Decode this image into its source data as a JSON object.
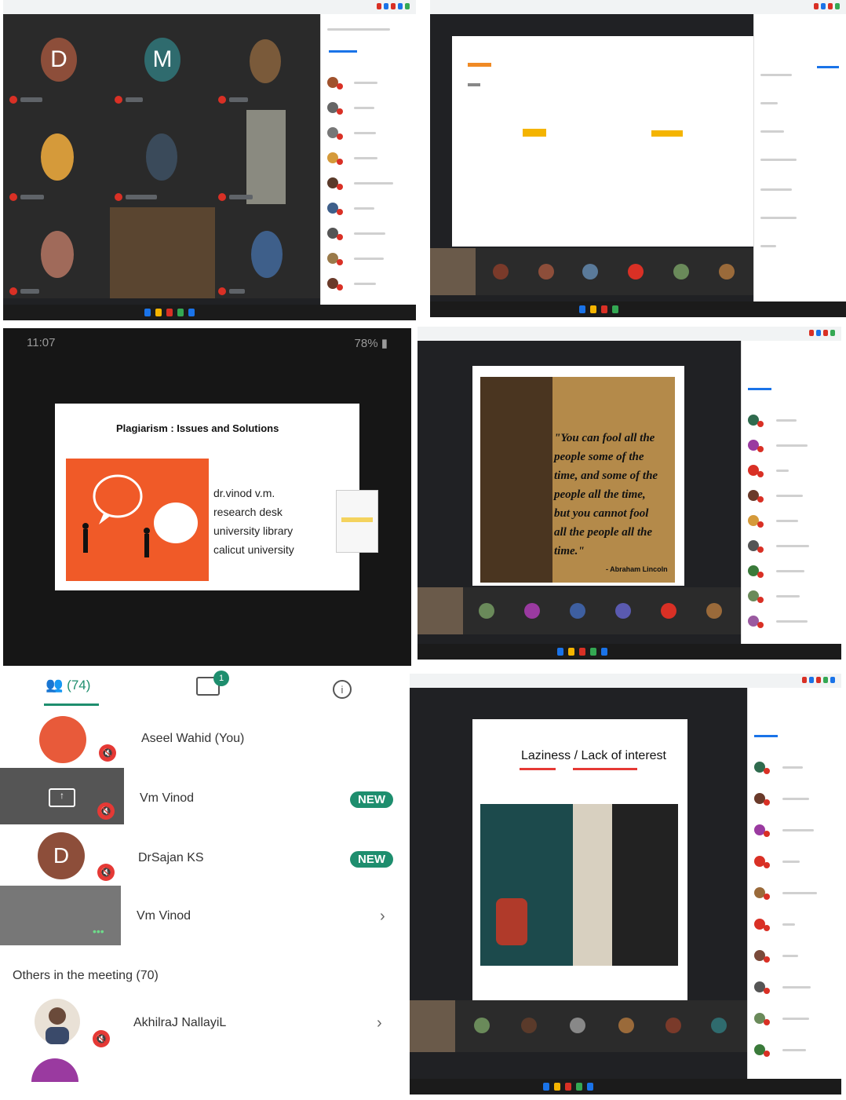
{
  "panel3": {
    "status_time": "11:07",
    "battery": "78%",
    "slide_title": "Plagiarism : Issues and Solutions",
    "author_lines": [
      "dr.vinod v.m.",
      "research desk",
      "university library",
      "calicut university"
    ]
  },
  "panel4": {
    "quote_lines": [
      "\"You can fool all the",
      "people some of the",
      "time, and some of the",
      "people all the time,",
      "but you cannot fool",
      "all the people all the",
      "time.\""
    ],
    "attribution": "- Abraham Lincoln"
  },
  "panel5": {
    "tabs": {
      "people_count": "(74)",
      "chat_badge": "1"
    },
    "participants": [
      {
        "name": "Aseel Wahid (You)",
        "badge": ""
      },
      {
        "name": "Vm Vinod",
        "badge": "NEW"
      },
      {
        "name": "DrSajan KS",
        "badge": "NEW",
        "initial": "D"
      },
      {
        "name": "Vm Vinod",
        "badge": ""
      }
    ],
    "others_heading": "Others in the meeting (70)",
    "others": [
      {
        "name": "AkhilraJ NallayiL"
      }
    ]
  },
  "panel6": {
    "slide_title_left": "Laziness",
    "slide_title_right": "Lack of interest"
  },
  "panel1": {
    "tiles": [
      {
        "initial": "D",
        "color": "#8d4e3a"
      },
      {
        "initial": "M",
        "color": "#2f6b6e"
      }
    ]
  },
  "colors": {
    "meet_dark": "#202124",
    "mic_red": "#d93025",
    "new_green": "#1e8e6e",
    "slide_orange": "#f05a28"
  }
}
